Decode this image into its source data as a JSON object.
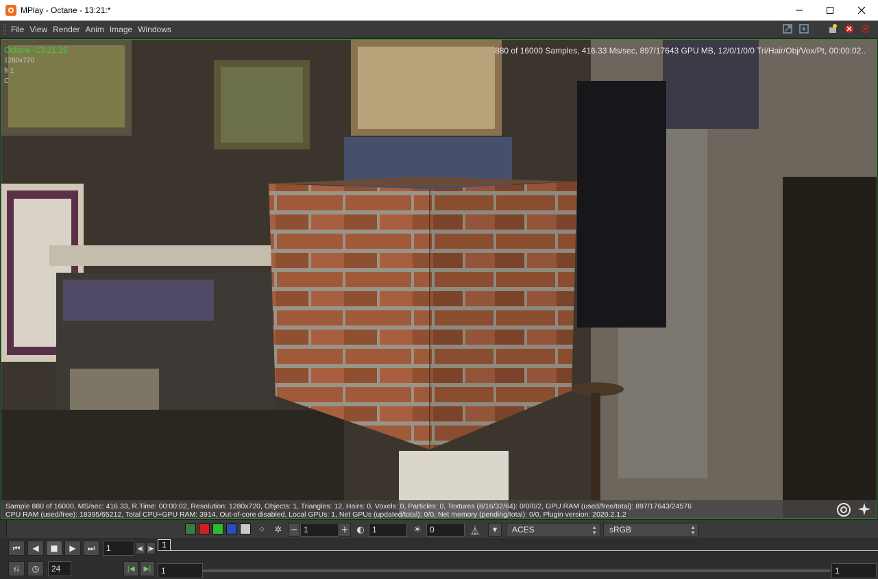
{
  "window": {
    "title": "MPlay - Octane - 13:21:*",
    "minimize_icon": "minimize-icon",
    "maximize_icon": "maximize-icon",
    "close_icon": "close-icon"
  },
  "menu": {
    "items": [
      "File",
      "View",
      "Render",
      "Anim",
      "Image",
      "Windows"
    ],
    "right_icons": [
      "fit-view-icon",
      "save-image-icon",
      "new-light-icon",
      "stop-render-icon",
      "settings-red-icon"
    ]
  },
  "viewport": {
    "render_label": "Octane -13:21:16",
    "resolution": "1280x720",
    "frame": "fr 1",
    "channel": "C",
    "stats": "880 of 16000 Samples, 416.33 Ms/sec, 897/17643 GPU MB, 12/0/1/0/0 Tri/Hair/Obj/Vox/Pt, 00:00:02..",
    "info_line1": "Sample 880 of 16000, MS/sec: 416.33, R.Time: 00:00:02, Resolution: 1280x720, Objects: 1, Triangles: 12, Hairs: 0, Voxels: 0, Particles: 0, Textures (8/16/32/64): 0/0/0/2, GPU RAM (used/free/total): 897/17643/24576",
    "info_line2": "CPU RAM (used/free): 18395/65212, Total CPU+GPU RAM: 3914, Out-of-core disabled, Local GPUs: 1, Net GPUs (updated/total): 0/0, Net memory (pending/total): 0/0, Plugin version: 2020.2.1.2"
  },
  "toolbar": {
    "swatch_colors": [
      "#3a7c3a",
      "#d11f1f",
      "#2ebc2e",
      "#2a4fb5",
      "#c9c9c9"
    ],
    "minus_label": "−",
    "plus_label": "+",
    "value1": "1",
    "value2": "1",
    "value3": "0",
    "lut": "ACES",
    "colorspace": "sRGB"
  },
  "playback": {
    "current_frame": "1",
    "fps": "24",
    "marker_frame": "1",
    "range_start": "1",
    "range_end": "1"
  }
}
